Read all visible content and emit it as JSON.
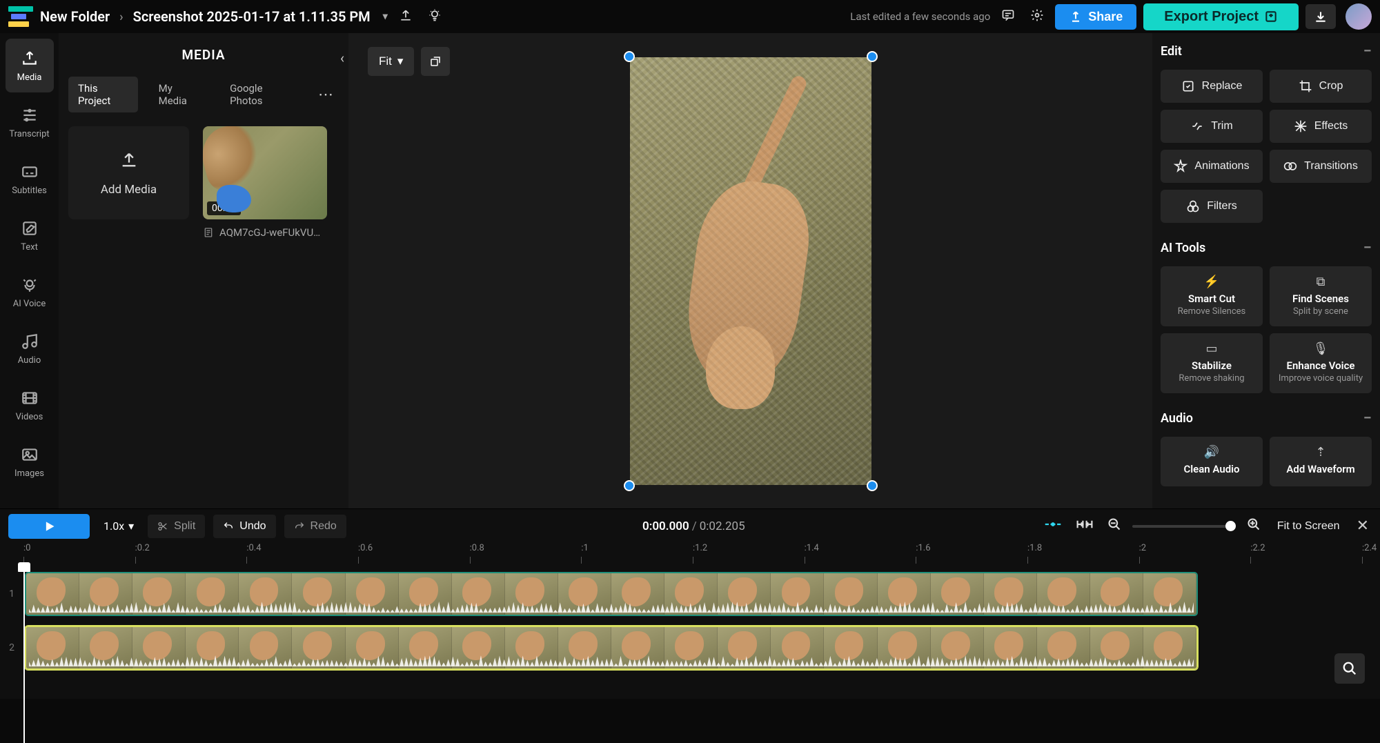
{
  "header": {
    "folder": "New Folder",
    "title": "Screenshot 2025-01-17 at 1.11.35 PM",
    "last_edited": "Last edited a few seconds ago",
    "share": "Share",
    "export": "Export Project"
  },
  "vtabs": [
    {
      "id": "media",
      "label": "Media",
      "icon": "⬆",
      "active": true
    },
    {
      "id": "transcript",
      "label": "Transcript",
      "icon": "≣"
    },
    {
      "id": "subtitles",
      "label": "Subtitles",
      "icon": "▭"
    },
    {
      "id": "text",
      "label": "Text",
      "icon": "✎"
    },
    {
      "id": "aivoice",
      "label": "AI Voice",
      "icon": "◉"
    },
    {
      "id": "audio",
      "label": "Audio",
      "icon": "♪"
    },
    {
      "id": "videos",
      "label": "Videos",
      "icon": "▦"
    },
    {
      "id": "images",
      "label": "Images",
      "icon": "▣"
    }
  ],
  "media_panel": {
    "title": "MEDIA",
    "tabs": [
      "This Project",
      "My Media",
      "Google Photos"
    ],
    "active_tab": "This Project",
    "add_media": "Add Media",
    "clip": {
      "duration": "00:02",
      "filename": "AQM7cGJ-weFUkVU…"
    }
  },
  "canvas": {
    "fit_label": "Fit"
  },
  "right_panel": {
    "edit": {
      "title": "Edit",
      "buttons": {
        "replace": "Replace",
        "crop": "Crop",
        "trim": "Trim",
        "effects": "Effects",
        "animations": "Animations",
        "transitions": "Transitions",
        "filters": "Filters"
      }
    },
    "ai": {
      "title": "AI Tools",
      "items": [
        {
          "id": "smartcut",
          "title": "Smart Cut",
          "sub": "Remove Silences",
          "icon": "⚡"
        },
        {
          "id": "findscenes",
          "title": "Find Scenes",
          "sub": "Split by scene",
          "icon": "⧉"
        },
        {
          "id": "stabilize",
          "title": "Stabilize",
          "sub": "Remove shaking",
          "icon": "▭"
        },
        {
          "id": "enhancevoice",
          "title": "Enhance Voice",
          "sub": "Improve voice quality",
          "icon": "🎙"
        }
      ]
    },
    "audio": {
      "title": "Audio",
      "items": [
        {
          "id": "cleanaudio",
          "title": "Clean Audio",
          "sub": "",
          "icon": "🔊"
        },
        {
          "id": "addwaveform",
          "title": "Add Waveform",
          "sub": "",
          "icon": "⇡"
        }
      ]
    }
  },
  "timeline": {
    "speed": "1.0x",
    "split": "Split",
    "undo": "Undo",
    "redo": "Redo",
    "current": "0:00.000",
    "total": "0:02.205",
    "fit_to_screen": "Fit to Screen",
    "ticks": [
      ":0",
      ":0.2",
      ":0.4",
      ":0.6",
      ":0.8",
      ":1",
      ":1.2",
      ":1.4",
      ":1.6",
      ":1.8",
      ":2",
      ":2.2",
      ":2.4"
    ],
    "tracks": [
      1,
      2
    ]
  }
}
